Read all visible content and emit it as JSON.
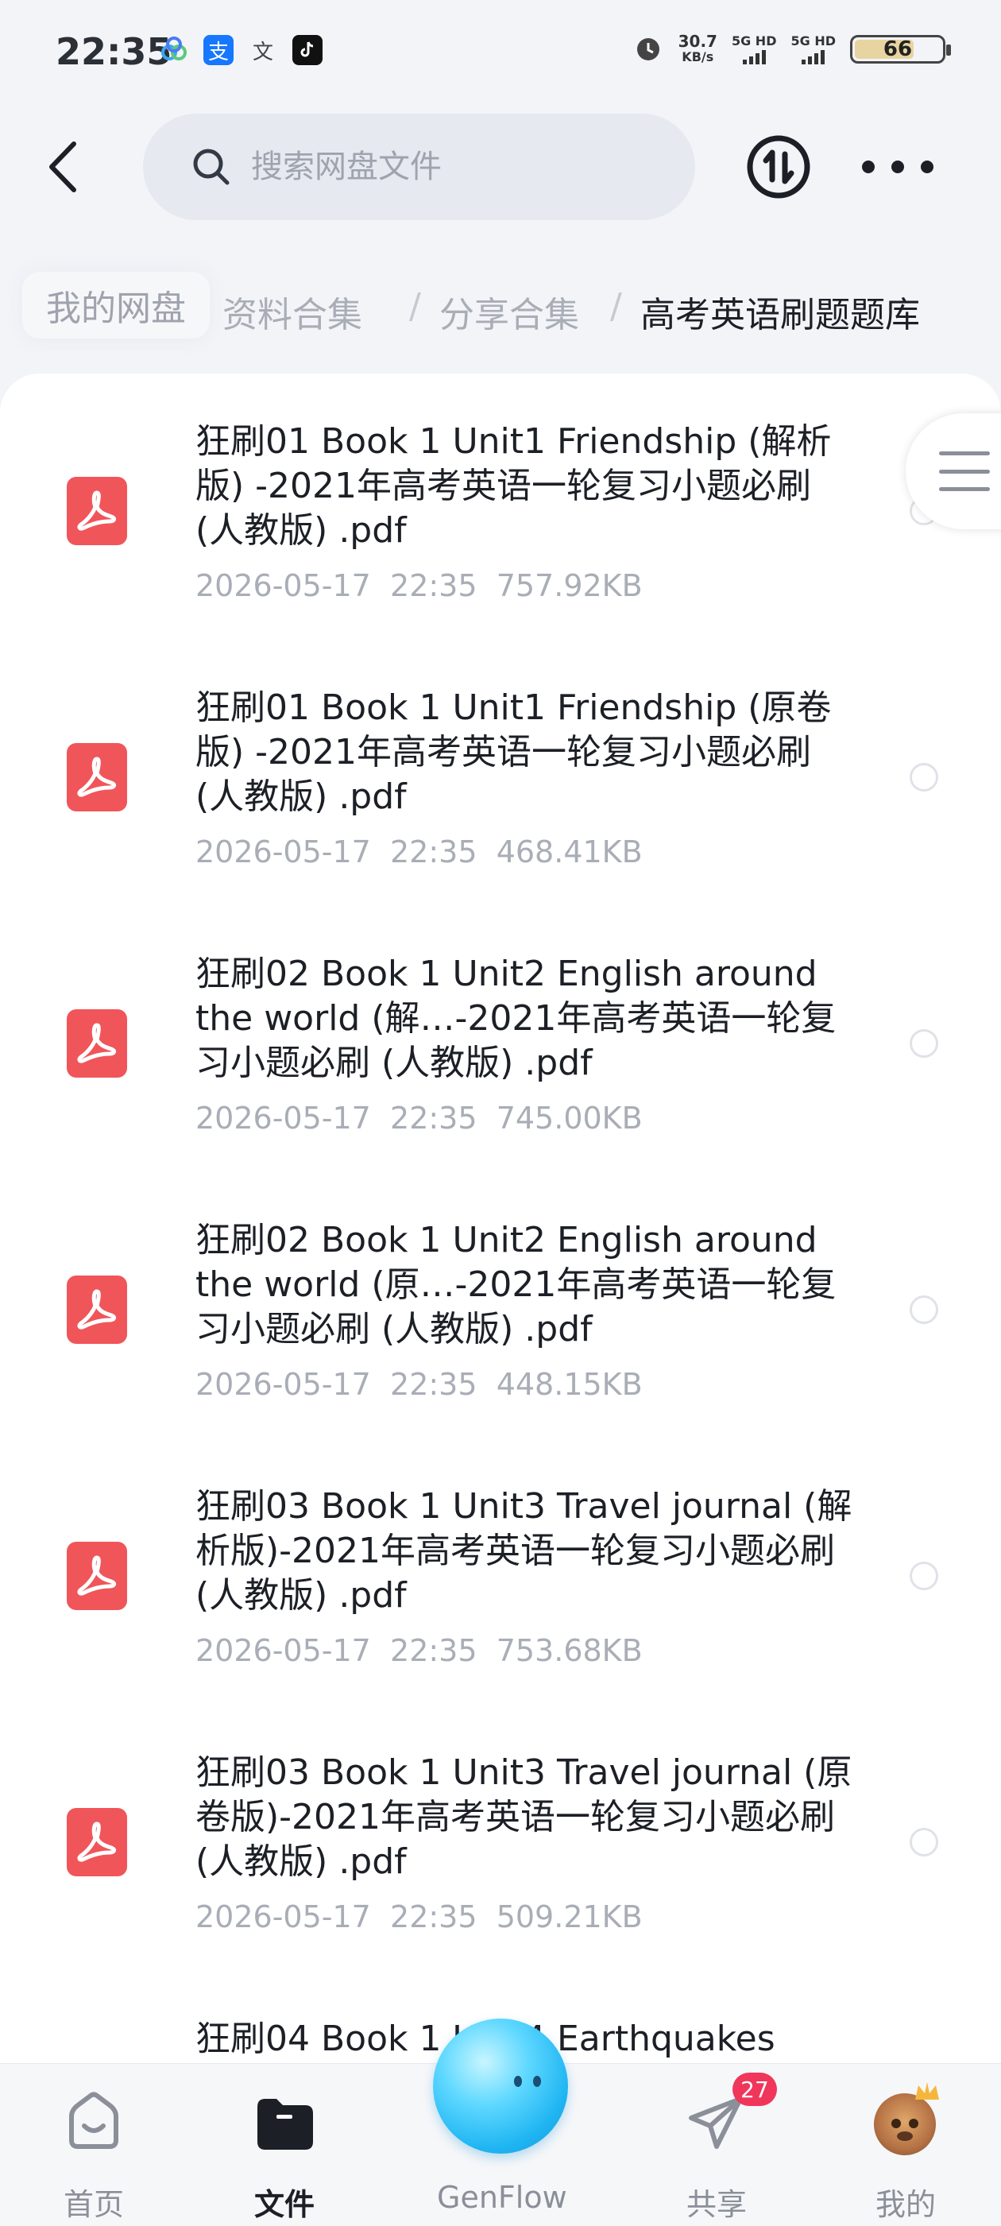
{
  "status_bar": {
    "time": "22:35",
    "app_icons": [
      "baidu-netdisk-icon",
      "alipay-icon",
      "translate-icon",
      "tiktok-icon"
    ],
    "alarm_icon": "alarm-icon",
    "speed_value": "30.7",
    "speed_unit": "KB/s",
    "network_1": "5G HD",
    "network_2": "5G HD",
    "battery": "66"
  },
  "top_nav": {
    "search_placeholder": "搜索网盘文件",
    "icons": [
      "back-icon",
      "search-icon",
      "transfer-icon",
      "more-icon"
    ]
  },
  "breadcrumb": {
    "home": "我的网盘",
    "items": [
      "资料合集",
      "分享合集"
    ],
    "separator": "/",
    "current": "高考英语刷题题库"
  },
  "files": [
    {
      "name": "狂刷01 Book 1 Unit1 Friendship (解析版) -2021年高考英语一轮复习小题必刷 (人教版) .pdf",
      "date": "2026-05-17",
      "time": "22:35",
      "size": "757.92KB"
    },
    {
      "name": "狂刷01 Book 1 Unit1 Friendship (原卷版) -2021年高考英语一轮复习小题必刷 (人教版) .pdf",
      "date": "2026-05-17",
      "time": "22:35",
      "size": "468.41KB"
    },
    {
      "name": "狂刷02 Book 1 Unit2 English around the world (解…-2021年高考英语一轮复习小题必刷 (人教版) .pdf",
      "date": "2026-05-17",
      "time": "22:35",
      "size": "745.00KB"
    },
    {
      "name": "狂刷02 Book 1 Unit2 English around the world (原…-2021年高考英语一轮复习小题必刷 (人教版) .pdf",
      "date": "2026-05-17",
      "time": "22:35",
      "size": "448.15KB"
    },
    {
      "name": "狂刷03 Book 1 Unit3 Travel journal (解析版)-2021年高考英语一轮复习小题必刷 (人教版) .pdf",
      "date": "2026-05-17",
      "time": "22:35",
      "size": "753.68KB"
    },
    {
      "name": "狂刷03 Book 1 Unit3 Travel journal (原卷版)-2021年高考英语一轮复习小题必刷 (人教版) .pdf",
      "date": "2026-05-17",
      "time": "22:35",
      "size": "509.21KB"
    },
    {
      "name": "狂刷04 Book 1 Unit4 Earthquakes",
      "date": "",
      "time": "",
      "size": ""
    }
  ],
  "bottom_nav": {
    "tabs": [
      {
        "label": "首页",
        "icon": "home-icon",
        "active": false
      },
      {
        "label": "文件",
        "icon": "folder-icon",
        "active": true
      },
      {
        "label": "GenFlow",
        "icon": "genflow-orb-icon",
        "active": false
      },
      {
        "label": "共享",
        "icon": "send-icon",
        "active": false
      },
      {
        "label": "我的",
        "icon": "avatar-icon",
        "active": false
      }
    ],
    "share_badge": "27"
  },
  "colors": {
    "pdf_icon": "#f0555a",
    "accent_text": "#1c1f26",
    "muted_text": "#a9adb6",
    "badge": "#f0365a"
  }
}
